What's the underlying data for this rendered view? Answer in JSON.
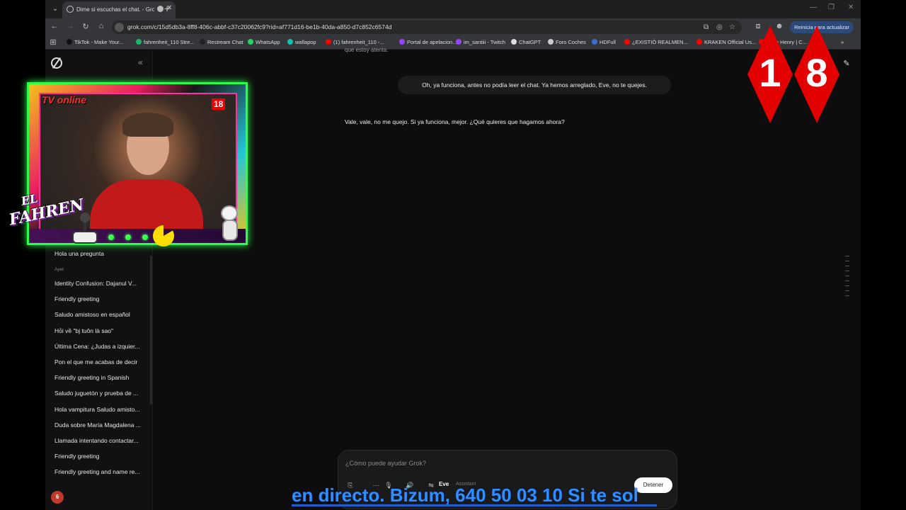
{
  "browser": {
    "tab_title": "Dime si escuchas el chat. - Grok",
    "url": "grok.com/c/15d5db3a-8ff8-406c-abbf-c37c20062fc9?rid=af771d16-be1b-40da-a850-d7c852c6574d",
    "restart_label": "Reinicia para actualizar",
    "bookmarks": [
      {
        "label": "TikTok - Make Your...",
        "color": "#111111"
      },
      {
        "label": "fahrenheit_110 Stre...",
        "color": "#1ab36a"
      },
      {
        "label": "Restream Chat",
        "color": "#222222"
      },
      {
        "label": "WhatsApp",
        "color": "#25d366"
      },
      {
        "label": "wallapop",
        "color": "#13c1ac"
      },
      {
        "label": "(1) fahrenheit_110 -...",
        "color": "#ff0000"
      },
      {
        "label": "Portal de apelacion...",
        "color": "#9146ff"
      },
      {
        "label": "im_santiii - Twitch",
        "color": "#9146ff"
      },
      {
        "label": "ChatGPT",
        "color": "#dddddd"
      },
      {
        "label": "Foro Coches",
        "color": "#cccccc"
      },
      {
        "label": "HDFull",
        "color": "#3a6cd6"
      },
      {
        "label": "¿EXISTIÓ REALMEN...",
        "color": "#ff0000"
      },
      {
        "label": "KRAKEN Official Us...",
        "color": "#ff0000"
      },
      {
        "label": "...ore Henry | C...",
        "color": "#ff0000"
      }
    ]
  },
  "sidebar": {
    "top_item": "Hola una pregunta",
    "section_yesterday": "Ayer",
    "items": [
      "Identity Confusion: Dajanul V...",
      "Friendly greeting",
      "Saludo amistoso en español",
      "Hỏi về \"bj tuôn là sao\"",
      "Última Cena: ¿Judas a izquier...",
      "Pon el que me acabas de decir",
      "Friendly greeting in Spanish",
      "Saludo juguetón y prueba de ...",
      "Hola vampitura Saludo amisto...",
      "Duda sobre María Magdalena ...",
      "Llamada intentando contactar...",
      "Friendly greeting",
      "Friendly greeting and name re..."
    ],
    "avatar_letter": "6"
  },
  "chat": {
    "top_cut_text": "que estoy atenta.",
    "user_message": "Oh, ya funciona, antes no podía leer el chat. Ya hemos arreglado, Eve, no te quejes.",
    "assistant_message": "Vale, vale, no me quejo. Si ya funciona, mejor. ¿Qué quieres que hagamos ahora?"
  },
  "composer": {
    "placeholder": "¿Cómo puede ayudar Grok?",
    "mode_name": "Eve",
    "mode_sub": "Assistant",
    "stop_label": "Detener"
  },
  "overlay": {
    "tv_online": "TV online",
    "cam_rating": "18",
    "brand_el": "EL",
    "brand_fahren": "FAHREN",
    "rating_left": "1",
    "rating_right": "8",
    "subtitle": "en directo. Bizum, 640 50 03 10 Si te sol"
  },
  "colors": {
    "accent_green": "#2cff4a",
    "rating_red": "#e30000",
    "subtitle_blue": "#2f8fff"
  }
}
